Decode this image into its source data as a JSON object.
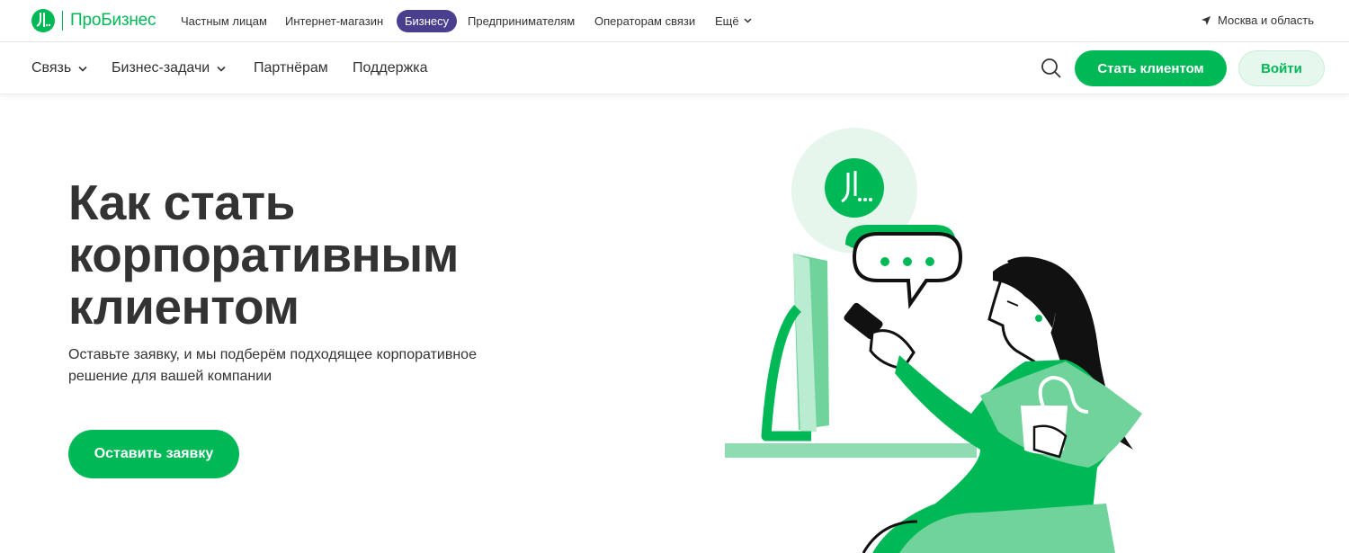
{
  "brand": {
    "name": "ПроБизнес",
    "accent": "#00b956",
    "active_segment_color": "#4a3f8f"
  },
  "segments": [
    {
      "label": "Частным лицам"
    },
    {
      "label": "Интернет-магазин"
    },
    {
      "label": "Бизнесу",
      "active": true
    },
    {
      "label": "Предпринимателям"
    },
    {
      "label": "Операторам связи"
    },
    {
      "label": "Ещё"
    }
  ],
  "region": {
    "label": "Москва и область",
    "icon": "location-arrow-icon"
  },
  "nav": {
    "items": [
      {
        "label": "Связь",
        "has_dropdown": true
      },
      {
        "label": "Бизнес-задачи",
        "has_dropdown": true
      },
      {
        "label": "Партнёрам"
      },
      {
        "label": "Поддержка"
      }
    ],
    "search_icon": "search-icon",
    "become_client_label": "Стать клиентом",
    "login_label": "Войти"
  },
  "hero": {
    "title": "Как стать корпоративным клиентом",
    "subtitle": "Оставьте заявку, и мы подберём подходящее корпоративное решение для вашей компании",
    "cta_label": "Оставить заявку",
    "illustration": "woman-with-phone-and-monitor-illustration"
  }
}
